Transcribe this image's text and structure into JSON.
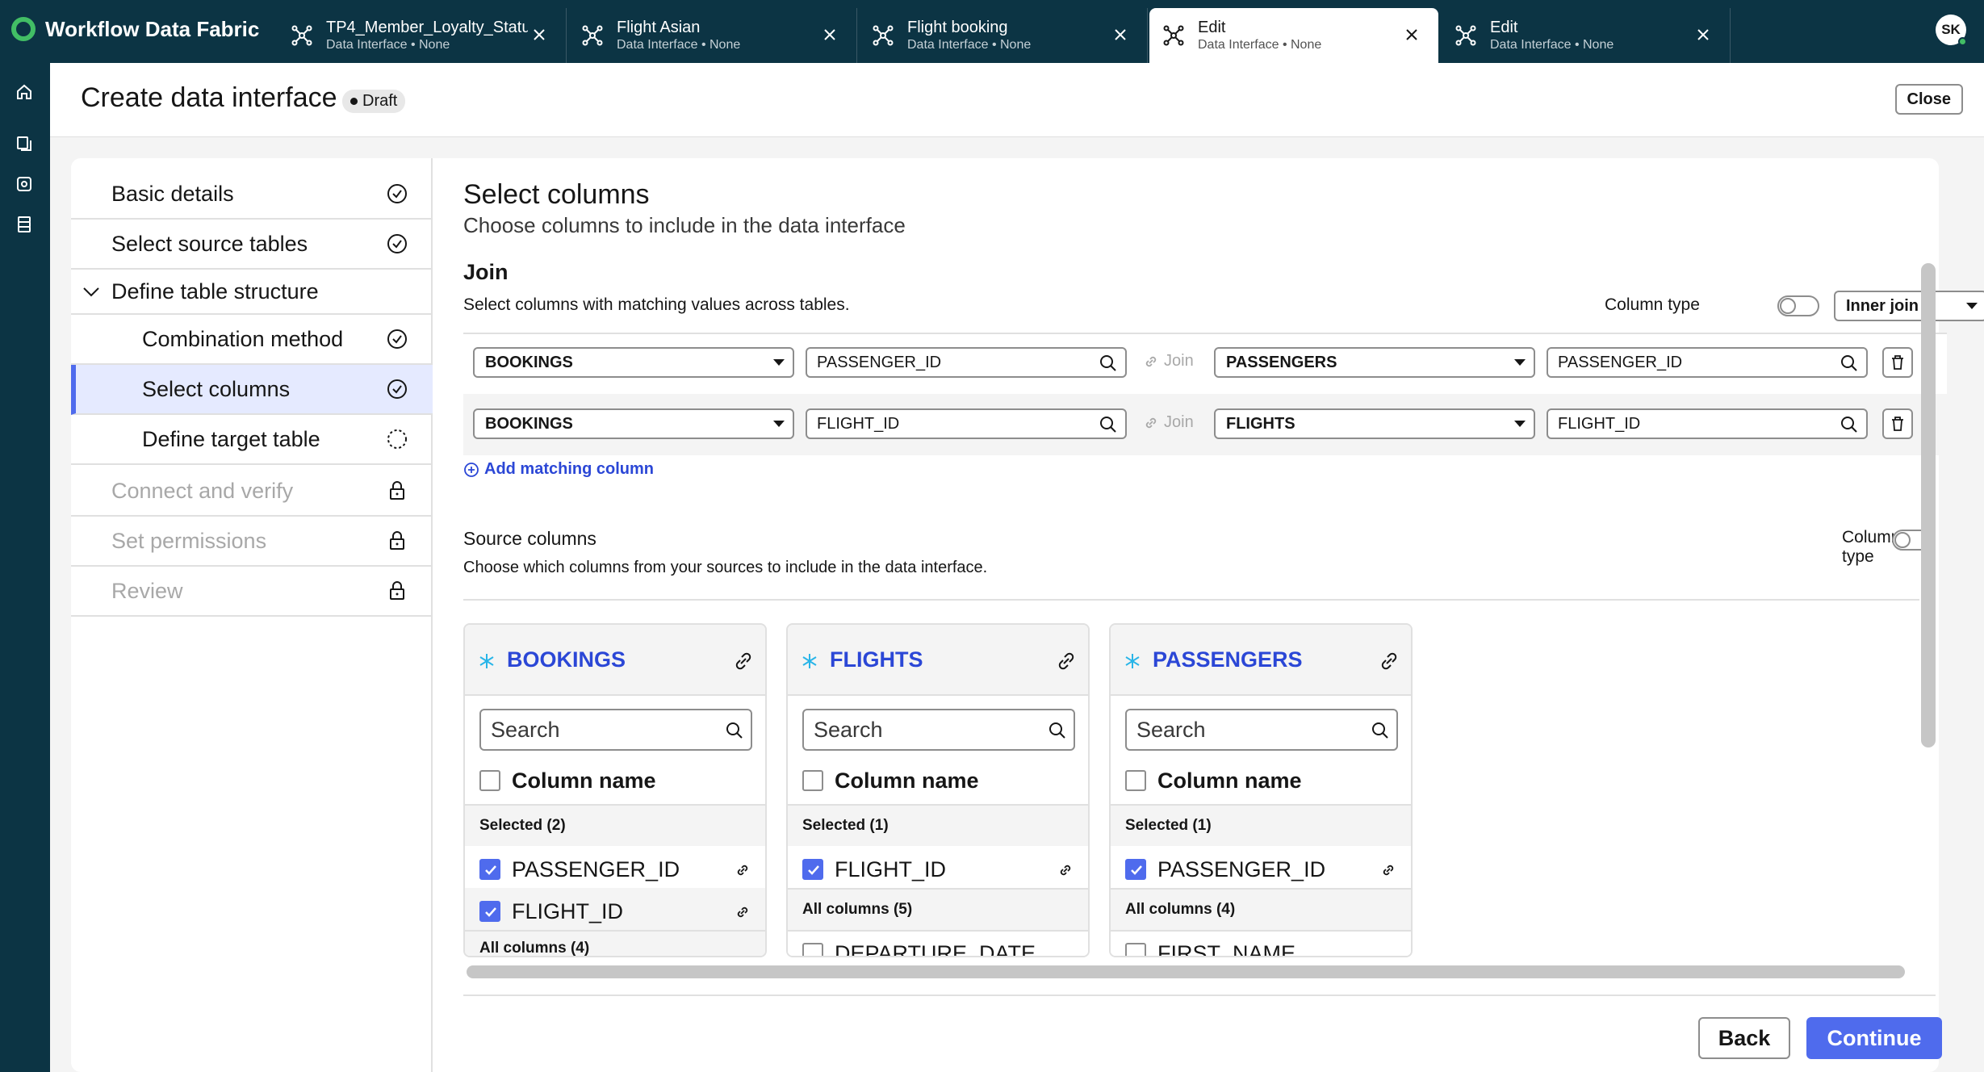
{
  "app": {
    "name": "Workflow Data Fabric",
    "user_initials": "SK"
  },
  "tabs": [
    {
      "title": "TP4_Member_Loyalty_Status",
      "sub": "Data Interface • None"
    },
    {
      "title": "Flight Asian",
      "sub": "Data Interface • None"
    },
    {
      "title": "Flight booking",
      "sub": "Data Interface • None"
    },
    {
      "title": "Edit",
      "sub": "Data Interface • None"
    },
    {
      "title": "Edit",
      "sub": "Data Interface • None"
    }
  ],
  "header": {
    "title": "Create data interface",
    "status": "Draft",
    "close_label": "Close"
  },
  "steps": [
    {
      "label": "Basic details",
      "state": "complete"
    },
    {
      "label": "Select source tables",
      "state": "complete"
    },
    {
      "label": "Define table structure",
      "state": "expanded"
    },
    {
      "label": "Combination method",
      "state": "complete"
    },
    {
      "label": "Select columns",
      "state": "current"
    },
    {
      "label": "Define target table",
      "state": "in-progress"
    },
    {
      "label": "Connect and verify",
      "state": "locked"
    },
    {
      "label": "Set permissions",
      "state": "locked"
    },
    {
      "label": "Review",
      "state": "locked"
    }
  ],
  "main": {
    "title": "Select columns",
    "subtitle": "Choose columns to include in the data interface",
    "join": {
      "heading": "Join",
      "description": "Select columns with matching values across tables.",
      "column_type_label": "Column type",
      "join_type": "Inner join",
      "join_label": "Join",
      "rows": [
        {
          "left_table": "BOOKINGS",
          "left_column": "PASSENGER_ID",
          "right_table": "PASSENGERS",
          "right_column": "PASSENGER_ID"
        },
        {
          "left_table": "BOOKINGS",
          "left_column": "FLIGHT_ID",
          "right_table": "FLIGHTS",
          "right_column": "FLIGHT_ID"
        }
      ],
      "add_label": "Add matching column"
    },
    "source": {
      "heading": "Source columns",
      "description": "Choose which columns from your sources to include in the data interface.",
      "column_type_label": "Column type",
      "search_placeholder": "Search",
      "column_name_label": "Column name",
      "tables": [
        {
          "name": "BOOKINGS",
          "selected_label": "Selected (2)",
          "selected": [
            "PASSENGER_ID",
            "FLIGHT_ID"
          ],
          "all_label": "All columns (4)",
          "all_first": ""
        },
        {
          "name": "FLIGHTS",
          "selected_label": "Selected (1)",
          "selected": [
            "FLIGHT_ID"
          ],
          "all_label": "All columns (5)",
          "all_first": "DEPARTURE_DATE"
        },
        {
          "name": "PASSENGERS",
          "selected_label": "Selected (1)",
          "selected": [
            "PASSENGER_ID"
          ],
          "all_label": "All columns (4)",
          "all_first": "FIRST_NAME"
        }
      ]
    },
    "footer": {
      "back_label": "Back",
      "continue_label": "Continue"
    }
  },
  "colors": {
    "topbar": "#0c3444",
    "accent": "#4f6bed",
    "link": "#2b47d6",
    "brand_green": "#42be65"
  },
  "icons": {
    "rail": [
      "home-icon",
      "data-icon",
      "settings-icon",
      "database-icon"
    ],
    "tab": "data-interface-icon",
    "step_states": {
      "complete": "check-circle-icon",
      "in-progress": "dashed-circle-icon",
      "locked": "lock-icon"
    }
  }
}
